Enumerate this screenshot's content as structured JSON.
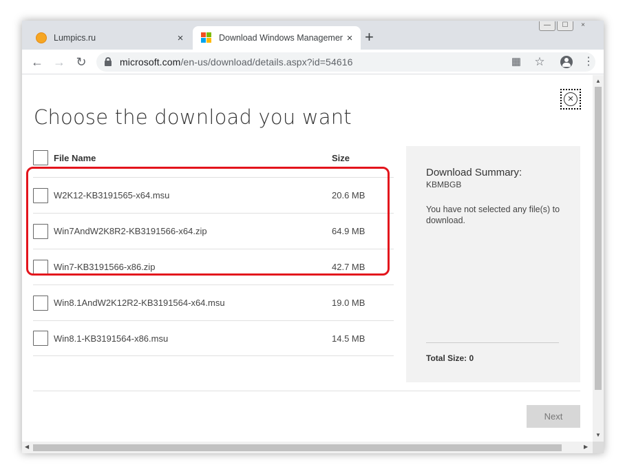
{
  "browser": {
    "tabs": [
      {
        "title": "Lumpics.ru",
        "favicon": "orange-circle-icon"
      },
      {
        "title": "Download Windows Management",
        "favicon": "microsoft-logo-icon",
        "active": true
      }
    ],
    "new_tab_label": "+",
    "close_label": "×",
    "window_controls": [
      "—",
      "☐",
      "×"
    ],
    "url_host": "microsoft.com",
    "url_path": "/en-us/download/details.aspx?id=54616"
  },
  "page": {
    "heading": "Choose the download you want",
    "columns": {
      "name": "File Name",
      "size": "Size"
    },
    "files": [
      {
        "name": "W2K12-KB3191565-x64.msu",
        "size": "20.6 MB"
      },
      {
        "name": "Win7AndW2K8R2-KB3191566-x64.zip",
        "size": "64.9 MB"
      },
      {
        "name": "Win7-KB3191566-x86.zip",
        "size": "42.7 MB"
      },
      {
        "name": "Win8.1AndW2K12R2-KB3191564-x64.msu",
        "size": "19.0 MB"
      },
      {
        "name": "Win8.1-KB3191564-x86.msu",
        "size": "14.5 MB"
      }
    ],
    "summary": {
      "title": "Download Summary:",
      "sub": "KBMBGB",
      "message": "You have not selected any file(s) to download.",
      "total": "Total Size: 0"
    },
    "next_label": "Next",
    "close_label": "×"
  },
  "colors": {
    "highlight": "#e3141c",
    "summary_bg": "#f2f2f2"
  }
}
